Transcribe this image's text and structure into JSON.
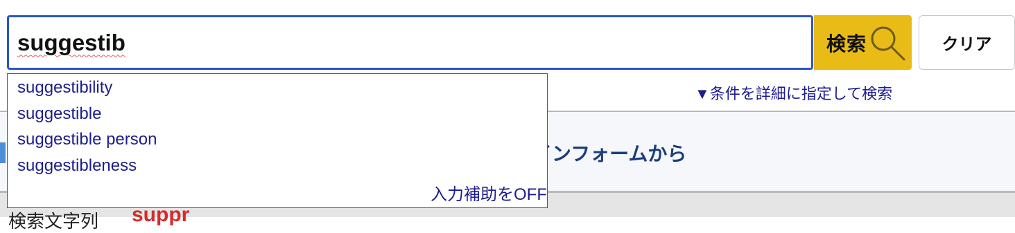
{
  "search": {
    "value": "suggestib",
    "button_label": "検索",
    "clear_label": "クリア"
  },
  "advanced_search": {
    "label": "▼条件を詳細に指定して検索"
  },
  "suggestions": {
    "items": [
      "suggestibility",
      "suggestible",
      "suggestible person",
      "suggestibleness"
    ],
    "toggle_off_label": "入力補助をOFF"
  },
  "banner": {
    "text": "インフォームから"
  },
  "lower": {
    "label": "検索文字列",
    "term": "suppr"
  },
  "colors": {
    "accent": "#2a56c6",
    "search_button": "#e8bb17",
    "link": "#1d1d8e",
    "term_highlight": "#d42b2b"
  },
  "icons": {
    "search_button": "magnifier-icon"
  }
}
